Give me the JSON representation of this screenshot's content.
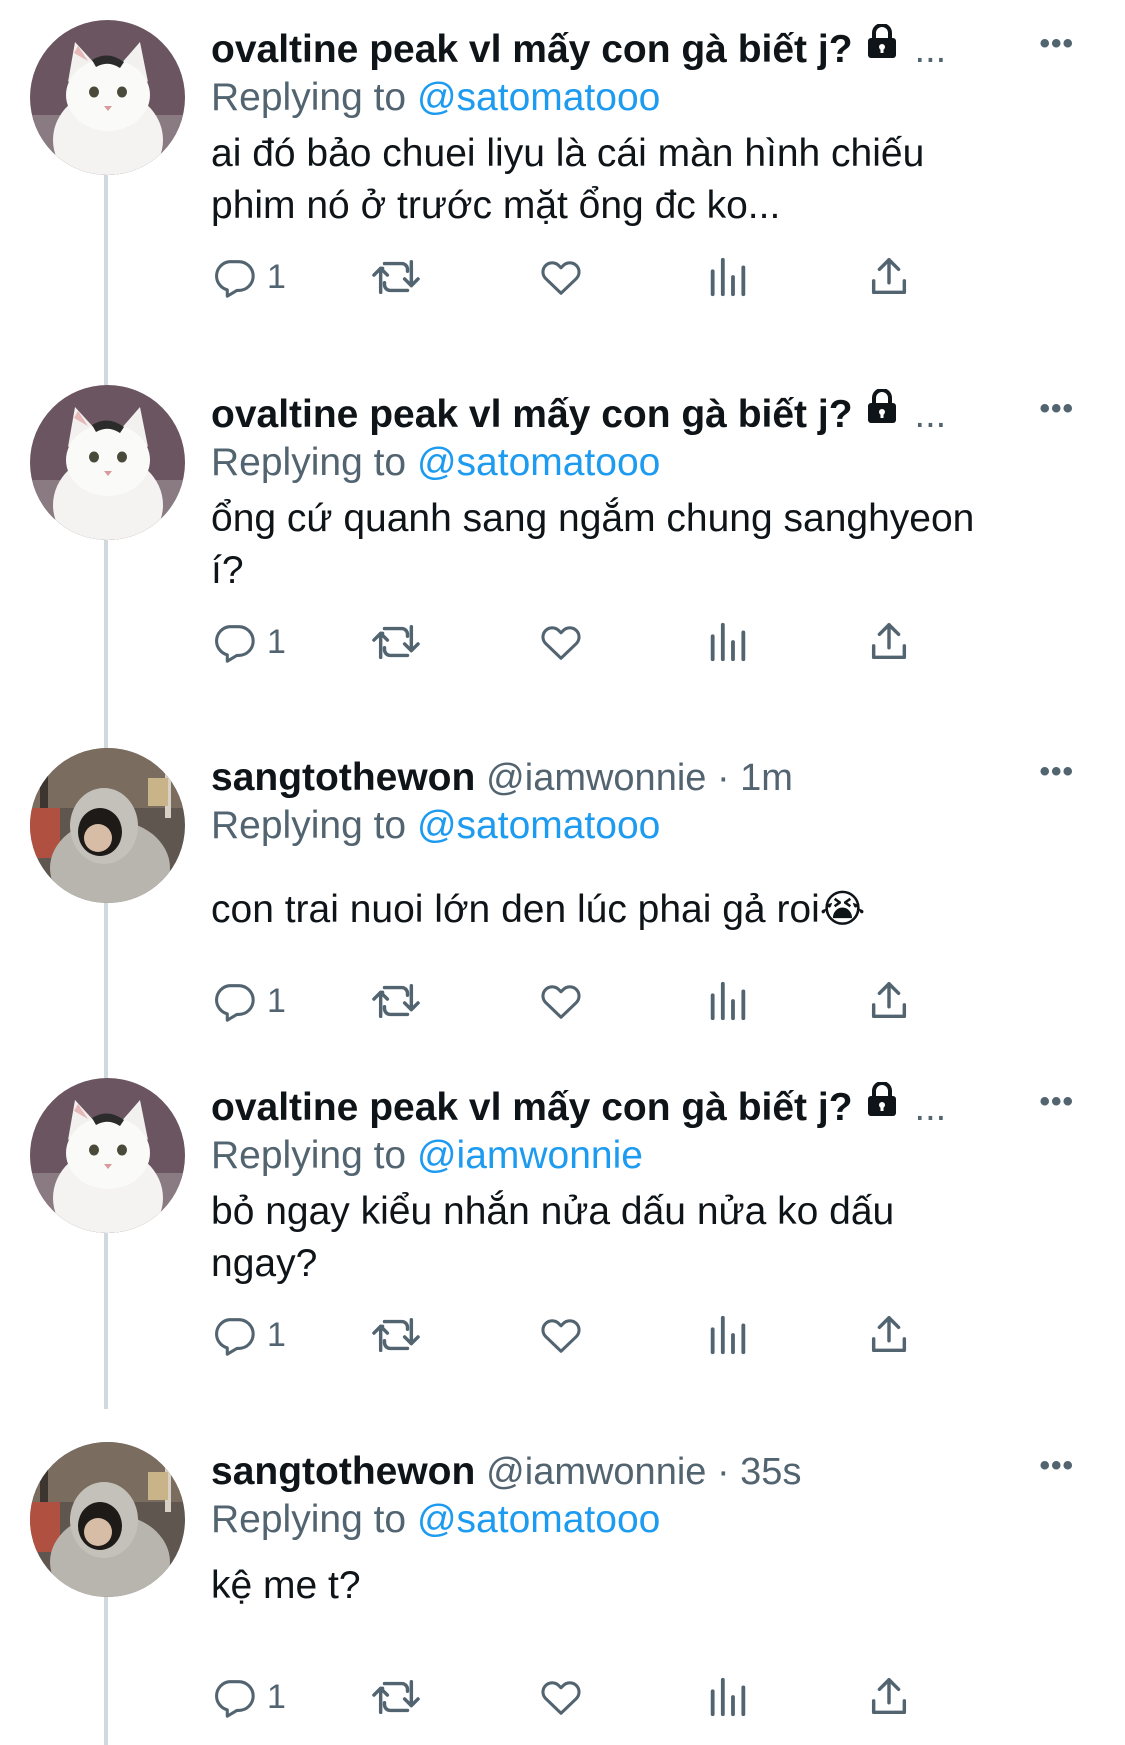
{
  "tweets": [
    {
      "name": "ovaltine peak vl mấy con gà biết j?",
      "handle": "",
      "time": "",
      "locked": true,
      "truncated": "...",
      "reply_prefix": "Replying to ",
      "reply_to": "@satomatooo",
      "text": "ai đó bảo chuei liyu là cái màn hình chiếu\nphim nó ở trước mặt ổng đc ko...",
      "replies": "1",
      "avatar": "cat-avatar"
    },
    {
      "name": "ovaltine peak vl mấy con gà biết j?",
      "handle": "",
      "time": "",
      "locked": true,
      "truncated": "...",
      "reply_prefix": "Replying to ",
      "reply_to": "@satomatooo",
      "text": "ổng cứ quanh sang ngắm chung sanghyeon\ní?",
      "replies": "1",
      "avatar": "cat-avatar"
    },
    {
      "name": "sangtothewon",
      "handle": "@iamwonnie",
      "time": " · 1m",
      "locked": false,
      "truncated": "",
      "reply_prefix": "Replying to ",
      "reply_to": "@satomatooo",
      "text": "con trai nuoi lớn den lúc phai gả roi😭",
      "replies": "1",
      "avatar": "person-avatar"
    },
    {
      "name": "ovaltine peak vl mấy con gà biết j?",
      "handle": "",
      "time": "",
      "locked": true,
      "truncated": "...",
      "reply_prefix": "Replying to ",
      "reply_to": "@iamwonnie",
      "text": "bỏ ngay kiểu nhắn nửa dấu nửa ko dấu\nngay?",
      "replies": "1",
      "avatar": "cat-avatar"
    },
    {
      "name": "sangtothewon",
      "handle": "@iamwonnie",
      "time": " · 35s",
      "locked": false,
      "truncated": "",
      "reply_prefix": "Replying to ",
      "reply_to": "@satomatooo",
      "text": "kệ me t?",
      "replies": "1",
      "avatar": "person-avatar"
    }
  ],
  "colors": {
    "text": "#0f1419",
    "secondary": "#536471",
    "link": "#1d9bf0",
    "thread_line": "#cfd9de"
  }
}
